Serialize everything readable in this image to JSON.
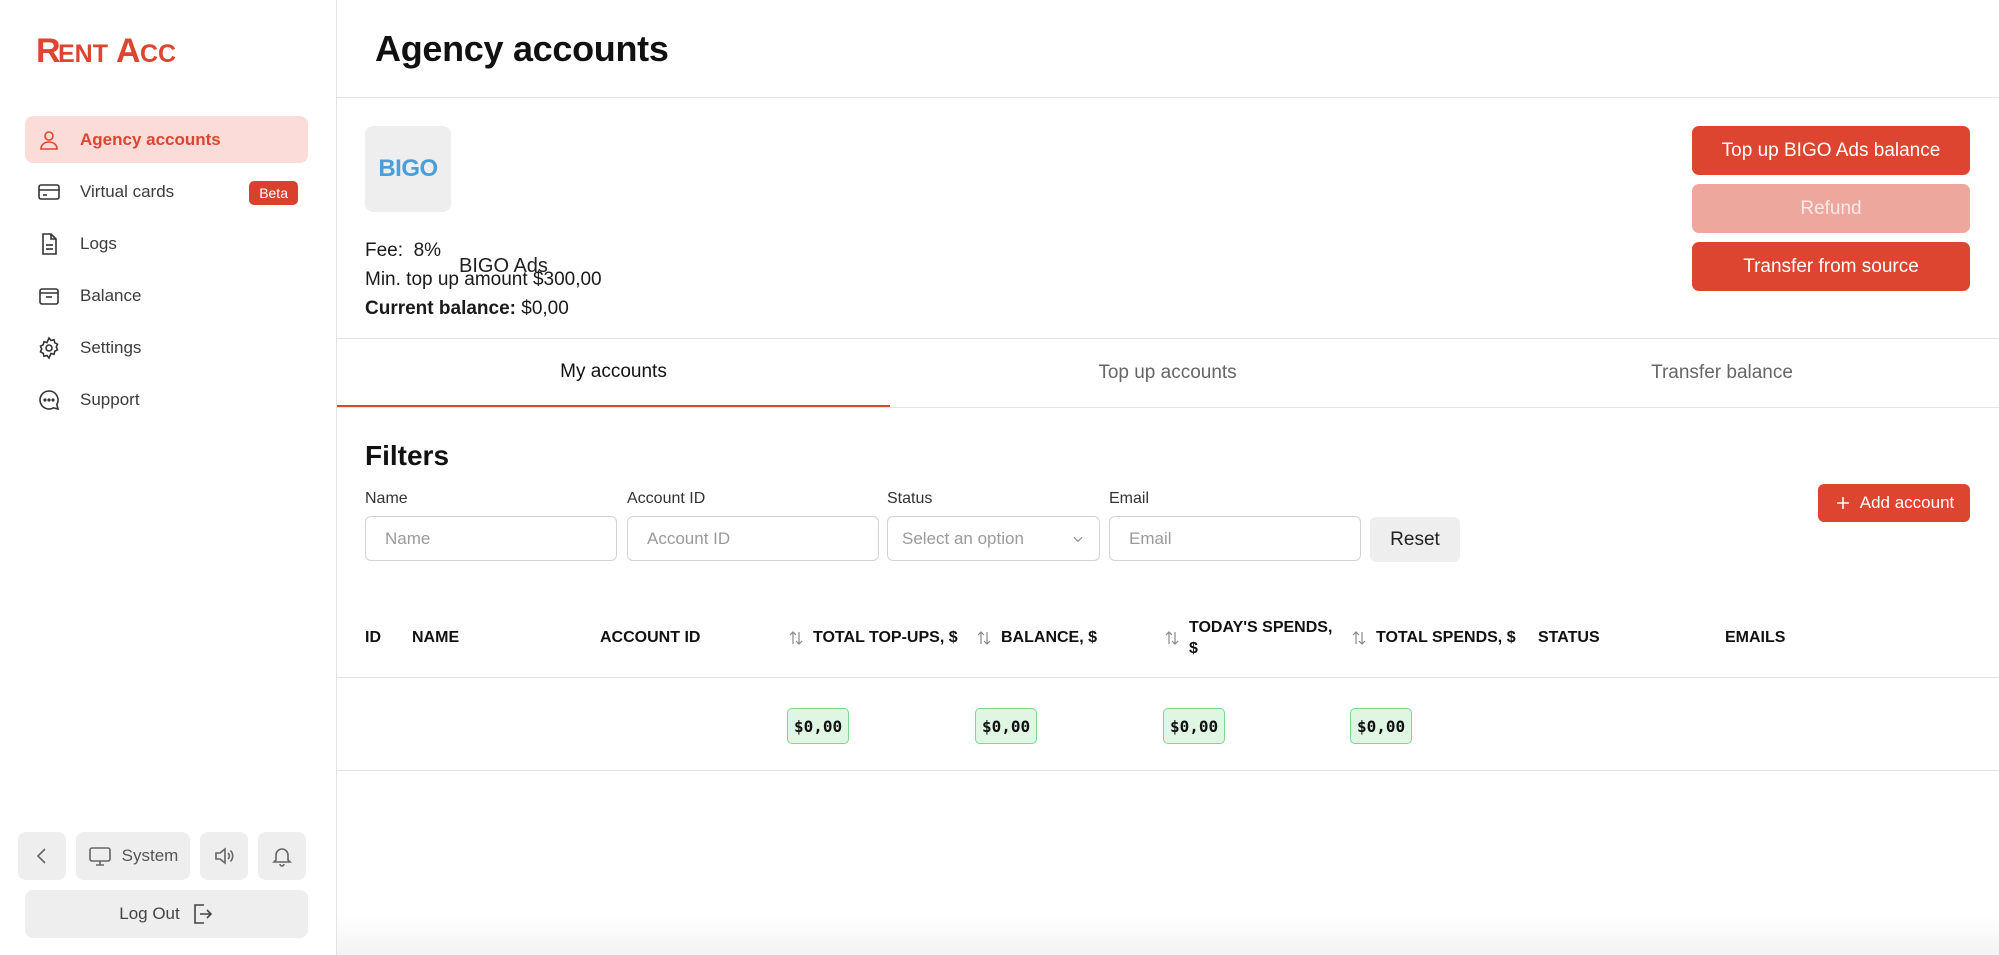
{
  "brand": {
    "logo_text": "RentAcc",
    "accent": "#dd4530"
  },
  "sidebar": {
    "items": [
      {
        "label": "Agency accounts",
        "icon": "user-icon",
        "active": true
      },
      {
        "label": "Virtual cards",
        "icon": "credit-card-icon",
        "badge": "Beta"
      },
      {
        "label": "Logs",
        "icon": "document-icon"
      },
      {
        "label": "Balance",
        "icon": "wallet-icon"
      },
      {
        "label": "Settings",
        "icon": "gear-icon"
      },
      {
        "label": "Support",
        "icon": "chat-icon"
      }
    ],
    "controls": {
      "theme_label": "System"
    },
    "logout_label": "Log Out"
  },
  "header": {
    "title": "Agency accounts"
  },
  "provider": {
    "logo_text": "BIGO",
    "name": "BIGO Ads",
    "fee_label": "Fee:",
    "fee_value": "8%",
    "min_topup_label": "Min. top up amount",
    "min_topup_value": "$300,00",
    "balance_label": "Current balance:",
    "balance_value": "$0,00",
    "buttons": {
      "topup": "Top up BIGO Ads balance",
      "refund": "Refund",
      "transfer": "Transfer from source"
    }
  },
  "tabs": [
    {
      "label": "My accounts",
      "active": true
    },
    {
      "label": "Top up accounts"
    },
    {
      "label": "Transfer balance"
    }
  ],
  "filters": {
    "title": "Filters",
    "name": {
      "label": "Name",
      "placeholder": "Name"
    },
    "account_id": {
      "label": "Account ID",
      "placeholder": "Account ID"
    },
    "status": {
      "label": "Status",
      "placeholder": "Select an option"
    },
    "email": {
      "label": "Email",
      "placeholder": "Email"
    },
    "reset_label": "Reset",
    "add_account_label": "Add account"
  },
  "table": {
    "columns": [
      "ID",
      "NAME",
      "ACCOUNT ID",
      "TOTAL TOP-UPS, $",
      "BALANCE, $",
      "TODAY'S SPENDS,",
      "$",
      "TOTAL SPENDS, $",
      "STATUS",
      "EMAILS"
    ],
    "totals": [
      "$0,00",
      "$0,00",
      "$0,00",
      "$0,00"
    ]
  }
}
